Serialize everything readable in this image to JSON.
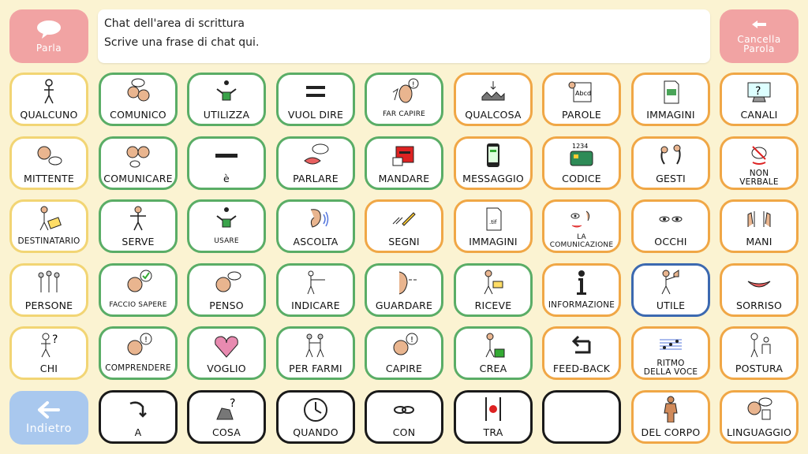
{
  "speak_button": {
    "label": "Parla"
  },
  "clear_button": {
    "label": "Cancella\nParola"
  },
  "back_button": {
    "label": "Indietro"
  },
  "chat": {
    "line1": "Chat dell'area di scrittura",
    "line2": "Scrive una frase di chat qui."
  },
  "colors": {
    "yellow": "#f2d574",
    "green": "#5aad66",
    "orange": "#f0a746",
    "blue": "#3c69b0",
    "black": "#1a1a1a",
    "speak": "#f1a3a3",
    "back": "#a9c8ee"
  },
  "grid": {
    "rows": [
      [
        {
          "label": "QUALCUNO",
          "color": "yellow",
          "icon": "person-icon"
        },
        {
          "label": "COMUNICO",
          "color": "green",
          "icon": "people-talking-icon"
        },
        {
          "label": "UTILIZZA",
          "color": "green",
          "icon": "hands-use-icon"
        },
        {
          "label": "VUOL DIRE",
          "color": "green",
          "icon": "equals-icon"
        },
        {
          "label": "FAR CAPIRE",
          "color": "green",
          "icon": "understand-icon",
          "small": true
        },
        {
          "label": "QUALCOSA",
          "color": "orange",
          "icon": "objects-icon"
        },
        {
          "label": "PAROLE",
          "color": "orange",
          "icon": "abcd-card-icon"
        },
        {
          "label": "IMMAGINI",
          "color": "orange",
          "icon": "picture-file-icon"
        },
        {
          "label": "CANALI",
          "color": "orange",
          "icon": "monitor-question-icon"
        }
      ],
      [
        {
          "label": "MITTENTE",
          "color": "yellow",
          "icon": "speaker-head-icon"
        },
        {
          "label": "COMUNICARE",
          "color": "green",
          "icon": "two-heads-talking-icon"
        },
        {
          "label": "è",
          "color": "green",
          "icon": "dash-icon"
        },
        {
          "label": "PARLARE",
          "color": "green",
          "icon": "mouth-speech-icon"
        },
        {
          "label": "MANDARE",
          "color": "green",
          "icon": "mailbox-icon"
        },
        {
          "label": "MESSAGGIO",
          "color": "orange",
          "icon": "phone-message-icon"
        },
        {
          "label": "CODICE",
          "color": "orange",
          "icon": "card-code-icon"
        },
        {
          "label": "GESTI",
          "color": "orange",
          "icon": "gesture-hands-icon"
        },
        {
          "label": "NON\nVERBALE",
          "color": "orange",
          "icon": "no-speech-icon",
          "small2": true
        }
      ],
      [
        {
          "label": "DESTINATARIO",
          "color": "yellow",
          "icon": "reader-icon",
          "small2": true
        },
        {
          "label": "SERVE",
          "color": "green",
          "icon": "serve-person-icon"
        },
        {
          "label": "USARE",
          "color": "green",
          "icon": "hands-use-icon",
          "small": true
        },
        {
          "label": "ASCOLTA",
          "color": "green",
          "icon": "ear-icon"
        },
        {
          "label": "SEGNI",
          "color": "orange",
          "icon": "pencil-marks-icon"
        },
        {
          "label": "IMMAGINI",
          "color": "orange",
          "icon": "tif-file-icon"
        },
        {
          "label": "LA\nCOMUNICAZIONE",
          "color": "orange",
          "icon": "face-senses-icon",
          "small": true
        },
        {
          "label": "OCCHI",
          "color": "orange",
          "icon": "eyes-icon"
        },
        {
          "label": "MANI",
          "color": "orange",
          "icon": "hands-icon"
        }
      ],
      [
        {
          "label": "PERSONE",
          "color": "yellow",
          "icon": "group-people-icon"
        },
        {
          "label": "FACCIO SAPERE",
          "color": "green",
          "icon": "head-check-icon",
          "small": true
        },
        {
          "label": "PENSO",
          "color": "green",
          "icon": "head-thought-icon"
        },
        {
          "label": "INDICARE",
          "color": "green",
          "icon": "point-person-icon"
        },
        {
          "label": "GUARDARE",
          "color": "green",
          "icon": "face-look-icon"
        },
        {
          "label": "RICEVE",
          "color": "green",
          "icon": "receive-person-icon"
        },
        {
          "label": "INFORMAZIONE",
          "color": "orange",
          "icon": "info-icon",
          "small2": true
        },
        {
          "label": "UTILE",
          "color": "blue",
          "icon": "thumbs-up-icon"
        },
        {
          "label": "SORRISO",
          "color": "orange",
          "icon": "smile-icon"
        }
      ],
      [
        {
          "label": "CHI",
          "color": "yellow",
          "icon": "person-question-icon"
        },
        {
          "label": "COMPRENDERE",
          "color": "green",
          "icon": "head-exclaim-icon",
          "small2": true
        },
        {
          "label": "VOGLIO",
          "color": "green",
          "icon": "heart-icon"
        },
        {
          "label": "PER FARMI",
          "color": "green",
          "icon": "two-walkers-icon"
        },
        {
          "label": "CAPIRE",
          "color": "green",
          "icon": "head-exclaim-icon"
        },
        {
          "label": "CREA",
          "color": "green",
          "icon": "create-person-icon"
        },
        {
          "label": "FEED-BACK",
          "color": "orange",
          "icon": "return-arrow-icon"
        },
        {
          "label": "RITMO\nDELLA VOCE",
          "color": "orange",
          "icon": "rhythm-icon",
          "small2": true
        },
        {
          "label": "POSTURA",
          "color": "orange",
          "icon": "posture-icon"
        }
      ],
      [
        null,
        {
          "label": "A",
          "color": "black",
          "icon": "arrow-turn-icon"
        },
        {
          "label": "COSA",
          "color": "black",
          "icon": "thing-question-icon"
        },
        {
          "label": "QUANDO",
          "color": "black",
          "icon": "clock-icon"
        },
        {
          "label": "CON",
          "color": "black",
          "icon": "link-icon"
        },
        {
          "label": "TRA",
          "color": "black",
          "icon": "between-icon"
        },
        {
          "label": "",
          "color": "black",
          "icon": ""
        },
        {
          "label": "DEL CORPO",
          "color": "orange",
          "icon": "body-icon"
        },
        {
          "label": "LINGUAGGIO",
          "color": "orange",
          "icon": "language-icon"
        }
      ]
    ]
  }
}
